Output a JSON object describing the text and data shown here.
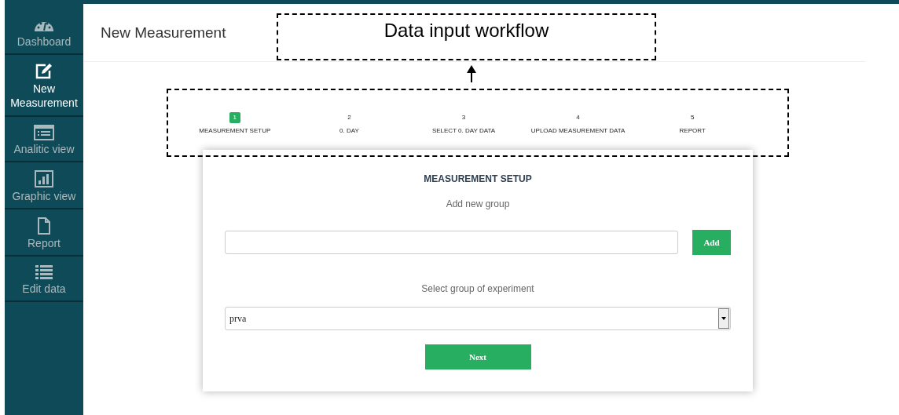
{
  "sidebar": {
    "items": [
      {
        "label": "Dashboard",
        "selected": false
      },
      {
        "label": "New Measurement",
        "selected": true
      },
      {
        "label": "Analitic view",
        "selected": false
      },
      {
        "label": "Graphic view",
        "selected": false
      },
      {
        "label": "Report",
        "selected": false
      },
      {
        "label": "Edit data",
        "selected": false
      }
    ]
  },
  "header": {
    "title": "New Measurement"
  },
  "annotation": {
    "label": "Data input workflow"
  },
  "steps": [
    {
      "number": "1",
      "label": "MEASUREMENT SETUP",
      "selected": true
    },
    {
      "number": "2",
      "label": "0. DAY",
      "selected": false
    },
    {
      "number": "3",
      "label": "SELECT 0. DAY DATA",
      "selected": false
    },
    {
      "number": "4",
      "label": "UPLOAD MEASUREMENT DATA",
      "selected": false
    },
    {
      "number": "5",
      "label": "REPORT",
      "selected": false
    }
  ],
  "card": {
    "title": "MEASUREMENT SETUP",
    "add_label": "Add new group",
    "add_button": "Add",
    "select_label": "Select group of experiment",
    "select_value": "prva",
    "next_button": "Next"
  }
}
